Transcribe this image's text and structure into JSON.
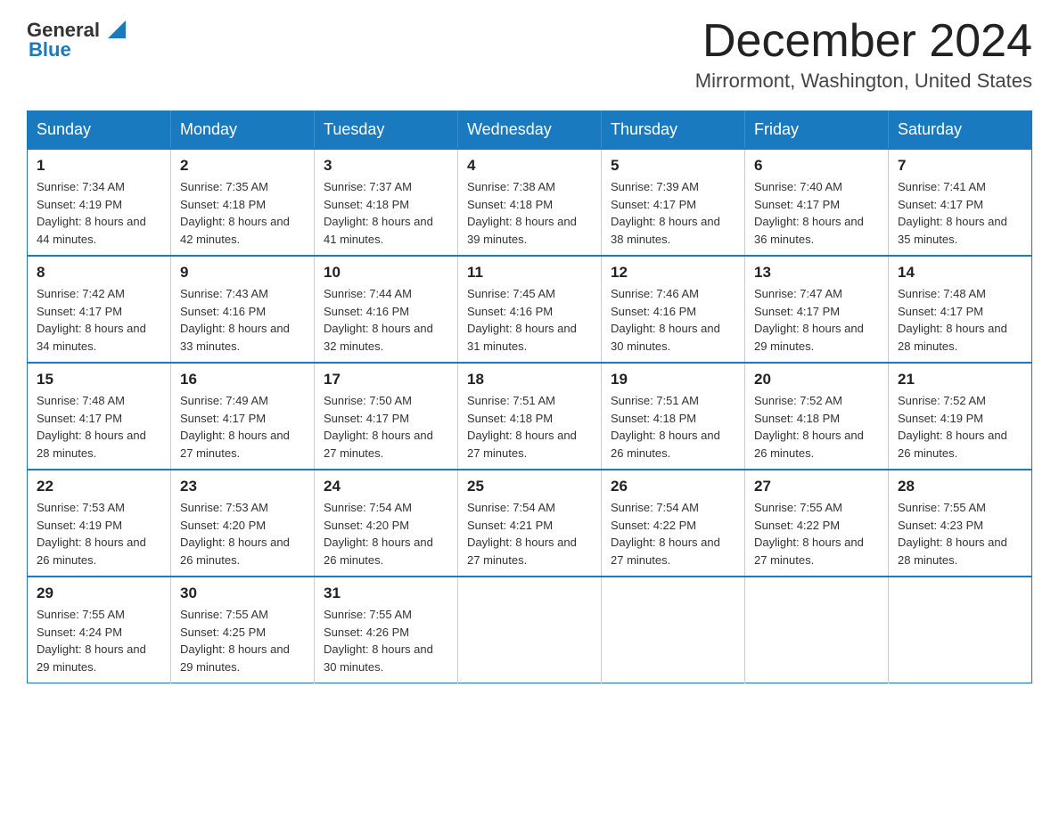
{
  "logo": {
    "general": "General",
    "blue": "Blue"
  },
  "title": "December 2024",
  "subtitle": "Mirrormont, Washington, United States",
  "weekdays": [
    "Sunday",
    "Monday",
    "Tuesday",
    "Wednesday",
    "Thursday",
    "Friday",
    "Saturday"
  ],
  "weeks": [
    [
      {
        "day": "1",
        "sunrise": "7:34 AM",
        "sunset": "4:19 PM",
        "daylight": "8 hours and 44 minutes."
      },
      {
        "day": "2",
        "sunrise": "7:35 AM",
        "sunset": "4:18 PM",
        "daylight": "8 hours and 42 minutes."
      },
      {
        "day": "3",
        "sunrise": "7:37 AM",
        "sunset": "4:18 PM",
        "daylight": "8 hours and 41 minutes."
      },
      {
        "day": "4",
        "sunrise": "7:38 AM",
        "sunset": "4:18 PM",
        "daylight": "8 hours and 39 minutes."
      },
      {
        "day": "5",
        "sunrise": "7:39 AM",
        "sunset": "4:17 PM",
        "daylight": "8 hours and 38 minutes."
      },
      {
        "day": "6",
        "sunrise": "7:40 AM",
        "sunset": "4:17 PM",
        "daylight": "8 hours and 36 minutes."
      },
      {
        "day": "7",
        "sunrise": "7:41 AM",
        "sunset": "4:17 PM",
        "daylight": "8 hours and 35 minutes."
      }
    ],
    [
      {
        "day": "8",
        "sunrise": "7:42 AM",
        "sunset": "4:17 PM",
        "daylight": "8 hours and 34 minutes."
      },
      {
        "day": "9",
        "sunrise": "7:43 AM",
        "sunset": "4:16 PM",
        "daylight": "8 hours and 33 minutes."
      },
      {
        "day": "10",
        "sunrise": "7:44 AM",
        "sunset": "4:16 PM",
        "daylight": "8 hours and 32 minutes."
      },
      {
        "day": "11",
        "sunrise": "7:45 AM",
        "sunset": "4:16 PM",
        "daylight": "8 hours and 31 minutes."
      },
      {
        "day": "12",
        "sunrise": "7:46 AM",
        "sunset": "4:16 PM",
        "daylight": "8 hours and 30 minutes."
      },
      {
        "day": "13",
        "sunrise": "7:47 AM",
        "sunset": "4:17 PM",
        "daylight": "8 hours and 29 minutes."
      },
      {
        "day": "14",
        "sunrise": "7:48 AM",
        "sunset": "4:17 PM",
        "daylight": "8 hours and 28 minutes."
      }
    ],
    [
      {
        "day": "15",
        "sunrise": "7:48 AM",
        "sunset": "4:17 PM",
        "daylight": "8 hours and 28 minutes."
      },
      {
        "day": "16",
        "sunrise": "7:49 AM",
        "sunset": "4:17 PM",
        "daylight": "8 hours and 27 minutes."
      },
      {
        "day": "17",
        "sunrise": "7:50 AM",
        "sunset": "4:17 PM",
        "daylight": "8 hours and 27 minutes."
      },
      {
        "day": "18",
        "sunrise": "7:51 AM",
        "sunset": "4:18 PM",
        "daylight": "8 hours and 27 minutes."
      },
      {
        "day": "19",
        "sunrise": "7:51 AM",
        "sunset": "4:18 PM",
        "daylight": "8 hours and 26 minutes."
      },
      {
        "day": "20",
        "sunrise": "7:52 AM",
        "sunset": "4:18 PM",
        "daylight": "8 hours and 26 minutes."
      },
      {
        "day": "21",
        "sunrise": "7:52 AM",
        "sunset": "4:19 PM",
        "daylight": "8 hours and 26 minutes."
      }
    ],
    [
      {
        "day": "22",
        "sunrise": "7:53 AM",
        "sunset": "4:19 PM",
        "daylight": "8 hours and 26 minutes."
      },
      {
        "day": "23",
        "sunrise": "7:53 AM",
        "sunset": "4:20 PM",
        "daylight": "8 hours and 26 minutes."
      },
      {
        "day": "24",
        "sunrise": "7:54 AM",
        "sunset": "4:20 PM",
        "daylight": "8 hours and 26 minutes."
      },
      {
        "day": "25",
        "sunrise": "7:54 AM",
        "sunset": "4:21 PM",
        "daylight": "8 hours and 27 minutes."
      },
      {
        "day": "26",
        "sunrise": "7:54 AM",
        "sunset": "4:22 PM",
        "daylight": "8 hours and 27 minutes."
      },
      {
        "day": "27",
        "sunrise": "7:55 AM",
        "sunset": "4:22 PM",
        "daylight": "8 hours and 27 minutes."
      },
      {
        "day": "28",
        "sunrise": "7:55 AM",
        "sunset": "4:23 PM",
        "daylight": "8 hours and 28 minutes."
      }
    ],
    [
      {
        "day": "29",
        "sunrise": "7:55 AM",
        "sunset": "4:24 PM",
        "daylight": "8 hours and 29 minutes."
      },
      {
        "day": "30",
        "sunrise": "7:55 AM",
        "sunset": "4:25 PM",
        "daylight": "8 hours and 29 minutes."
      },
      {
        "day": "31",
        "sunrise": "7:55 AM",
        "sunset": "4:26 PM",
        "daylight": "8 hours and 30 minutes."
      },
      null,
      null,
      null,
      null
    ]
  ]
}
